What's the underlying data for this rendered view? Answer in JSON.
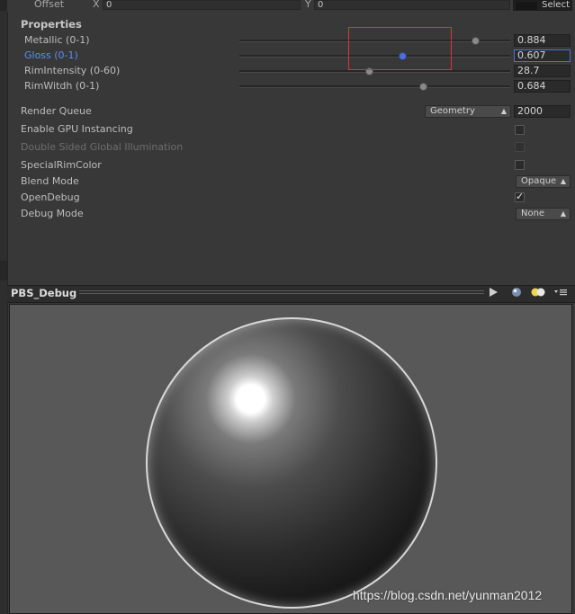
{
  "offset_row": {
    "label": "Offset",
    "x_label": "X",
    "x_value": "0",
    "y_label": "Y",
    "y_value": "0",
    "select_label": "Select"
  },
  "properties": {
    "title": "Properties",
    "sliders": [
      {
        "label": "Metallic (0-1)",
        "value": "0.884",
        "fraction": 0.884,
        "active": false
      },
      {
        "label": "Gloss (0-1)",
        "value": "0.607",
        "fraction": 0.607,
        "active": true
      },
      {
        "label": "RimIntensity (0-60)",
        "value": "28.7",
        "fraction": 0.478,
        "active": false
      },
      {
        "label": "RimWitdh (0-1)",
        "value": "0.684",
        "fraction": 0.684,
        "active": false
      }
    ]
  },
  "settings": {
    "render_queue": {
      "label": "Render Queue",
      "dropdown": "Geometry",
      "value": "2000"
    },
    "gpu_instancing": {
      "label": "Enable GPU Instancing",
      "checked": false
    },
    "double_sided_gi": {
      "label": "Double Sided Global Illumination",
      "checked": false,
      "disabled": true
    },
    "special_rim_color": {
      "label": "SpecialRimColor",
      "checked": false
    },
    "blend_mode": {
      "label": "Blend Mode",
      "dropdown": "Opaque"
    },
    "open_debug": {
      "label": "OpenDebug",
      "checked": true
    },
    "debug_mode": {
      "label": "Debug Mode",
      "dropdown": "None"
    }
  },
  "preview": {
    "title": "PBS_Debug",
    "play_icon": "play-icon",
    "sphere_icon": "sphere-icon",
    "light_icon": "light-icon",
    "menu_icon": "menu-icon"
  },
  "watermark": "https://blog.csdn.net/yunman2012",
  "colors": {
    "active_label": "#5c8ef2",
    "active_thumb": "#4f6fd8",
    "highlight_box": "#d13b3b",
    "background": "#383838"
  }
}
